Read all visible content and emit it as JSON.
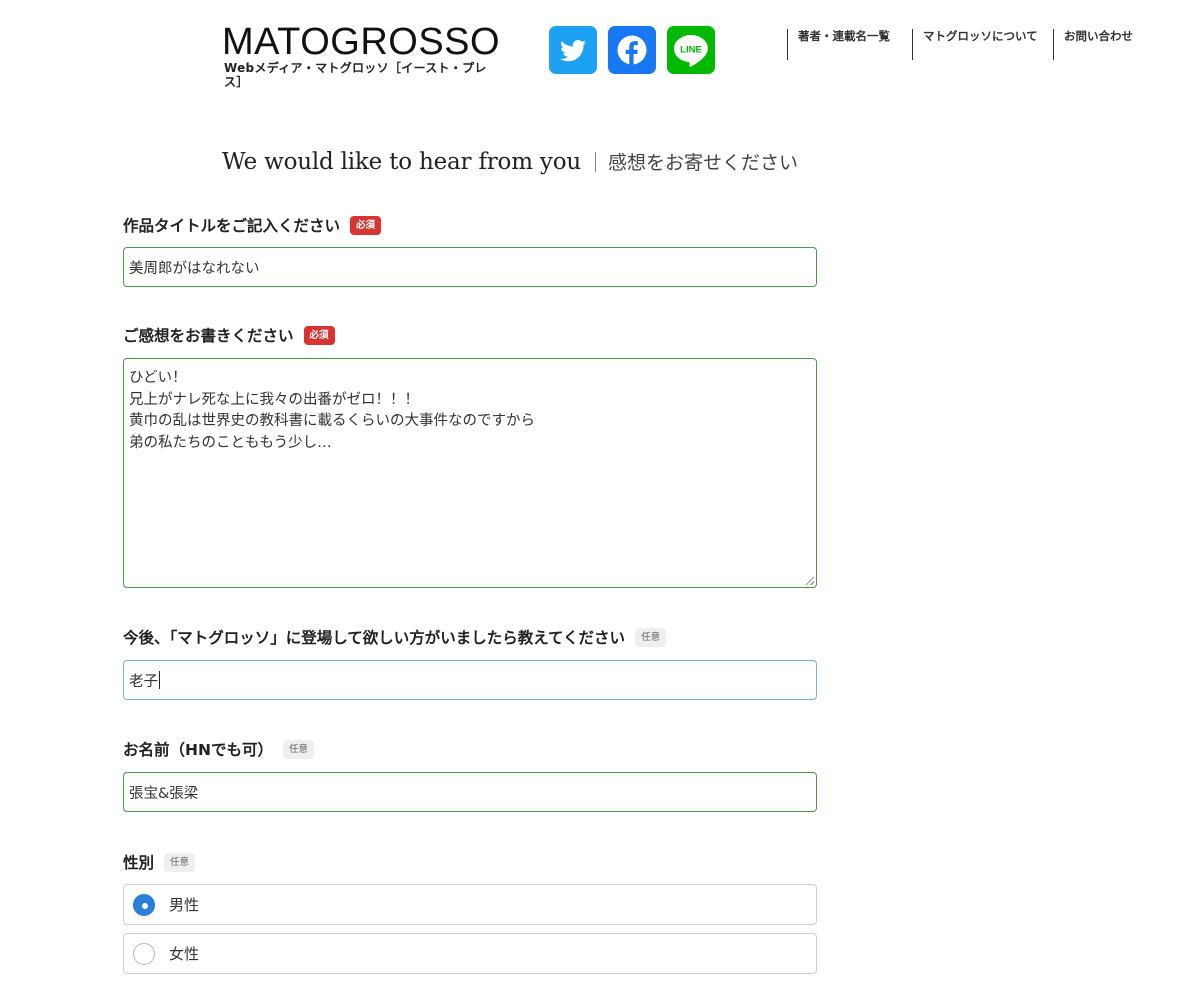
{
  "header": {
    "logo_main": "MATOGROSSO",
    "logo_sub": "Webメディア・マトグロッソ［イースト・プレス］",
    "social": [
      {
        "icon": "twitter-icon",
        "color": "#1da1f2"
      },
      {
        "icon": "facebook-icon",
        "color": "#1877f2"
      },
      {
        "icon": "line-icon",
        "color": "#00b900",
        "text": "LINE"
      }
    ],
    "nav": [
      "著者・連載名一覧",
      "マトグロッソについて",
      "お問い合わせ"
    ]
  },
  "heading": {
    "en": "We would like to hear from you",
    "jp": "感想をお寄せください"
  },
  "form": {
    "title_field": {
      "label": "作品タイトルをご記入ください",
      "badge": "必須",
      "value": "美周郎がはなれない"
    },
    "comment_field": {
      "label": "ご感想をお書きください",
      "badge": "必須",
      "lines": [
        "ひどい！",
        "兄上がナレ死な上に我々の出番がゼロ！！！",
        "黄巾の乱は世界史の教科書に載るくらいの大事件なのですから",
        "弟の私たちのことももう少し…"
      ]
    },
    "request_field": {
      "label": "今後、「マトグロッソ」に登場して欲しい方がいましたら教えてください",
      "badge": "任意",
      "value": "老子"
    },
    "name_field": {
      "label": "お名前（HNでも可）",
      "badge": "任意",
      "value": "張宝&張梁"
    },
    "gender_field": {
      "label": "性別",
      "badge": "任意",
      "options": [
        {
          "label": "男性",
          "checked": true
        },
        {
          "label": "女性",
          "checked": false
        }
      ]
    }
  }
}
